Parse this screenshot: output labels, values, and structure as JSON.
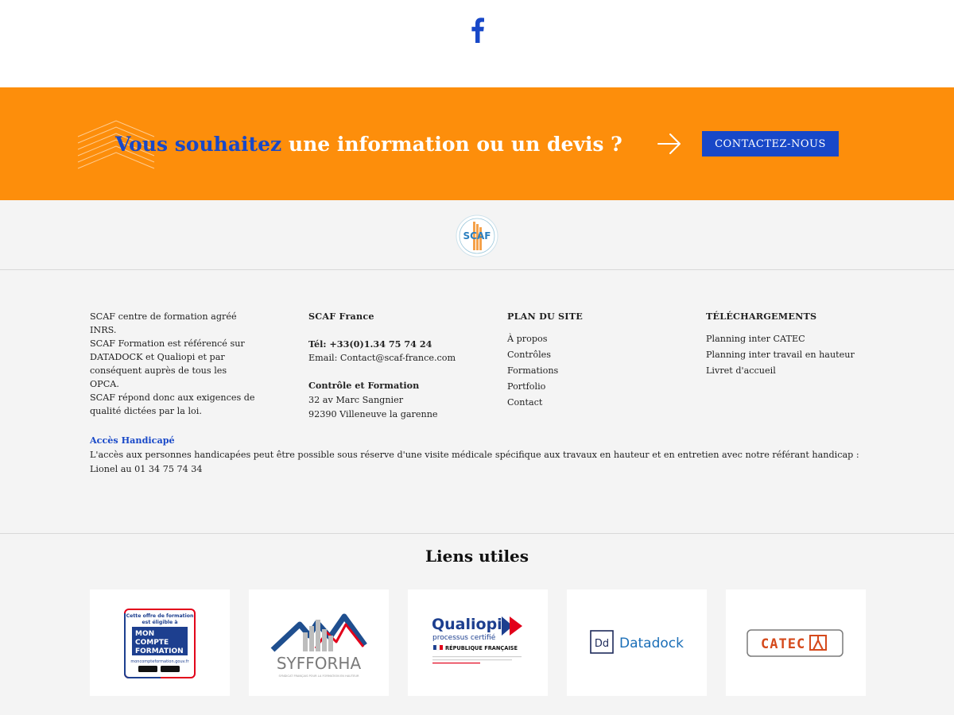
{
  "social": {
    "facebook_icon": "facebook-icon"
  },
  "cta": {
    "highlight": "Vous souhaitez",
    "rest": " une information ou un devis ?",
    "button_label": "CONTACTEZ-NOUS",
    "colors": {
      "band": "#fd8e0b",
      "accent": "#1848c8"
    }
  },
  "logo": {
    "text": "SCAF"
  },
  "footer": {
    "about": [
      "SCAF centre de formation agréé INRS.",
      "SCAF Formation est référencé sur",
      "DATADOCK et Qualiopi et par",
      "conséquent auprès de tous les OPCA.",
      "SCAF répond donc aux exigences de",
      "qualité dictées par la loi."
    ],
    "contact": {
      "title": "SCAF France",
      "tel": "Tél: +33(0)1.34 75 74 24",
      "email": "Email: Contact@scaf-france.com",
      "section": "Contrôle et Formation",
      "address1": "32 av Marc Sangnier",
      "address2": "92390 Villeneuve la garenne"
    },
    "plan": {
      "title": "PLAN DU SITE",
      "items": [
        "À propos",
        "Contrôles",
        "Formations",
        "Portfolio",
        "Contact"
      ]
    },
    "downloads": {
      "title": "TÉLÉCHARGEMENTS",
      "items": [
        "Planning inter CATEC",
        "Planning inter travail en hauteur",
        "Livret d'accueil"
      ]
    },
    "acces": {
      "title": "Accès Handicapé",
      "text": "L'accès aux personnes handicapées peut être possible sous réserve d'une visite médicale spécifique aux travaux en hauteur et en entretien avec notre référant handicap : Lionel au 01 34 75 74 34"
    }
  },
  "liens": {
    "title": "Liens utiles",
    "cards": [
      {
        "name": "moncompteformation",
        "lines": [
          "Cette offre de formation",
          "est éligible à",
          "MON",
          "COMPTE",
          "FORMATION",
          "moncompteformation.gouv.fr"
        ]
      },
      {
        "name": "sfforha",
        "text": "SYFFORHA",
        "sub": "SYNDICAT FRANÇAIS POUR LA FORMATION EN HAUTEUR"
      },
      {
        "name": "qualiopi",
        "text": "Qualiopi",
        "sub": "processus certifié",
        "rep": "RÉPUBLIQUE FRANÇAISE"
      },
      {
        "name": "datadock",
        "text": "Datadock",
        "mark": "Dd"
      },
      {
        "name": "catec",
        "text": "CATEC"
      }
    ]
  }
}
